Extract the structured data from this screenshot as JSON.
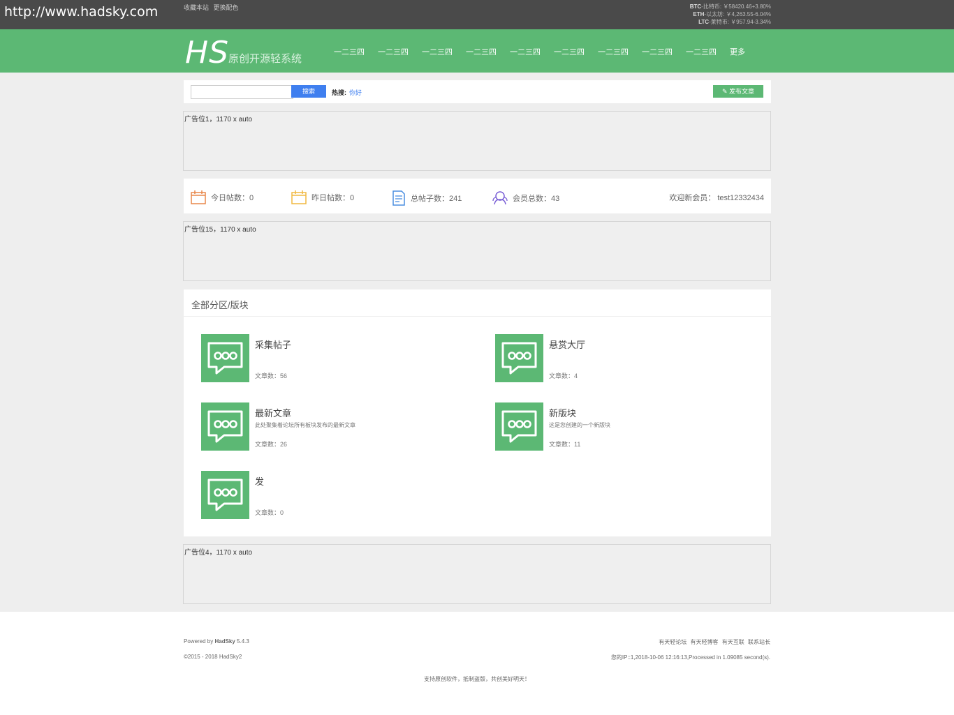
{
  "topbar": {
    "url": "http://www.hadsky.com",
    "links": [
      "收藏本站",
      "更换配色"
    ],
    "ticker": [
      {
        "name": "BTC",
        "desc": "-比特币: ￥58420.46+3.80%"
      },
      {
        "name": "ETH",
        "desc": "-以太坊: ￥4,263.55-6.04%"
      },
      {
        "name": "LTC",
        "desc": "-莱特币: ￥957.94-3.34%"
      }
    ]
  },
  "header": {
    "logo": "HS",
    "slogan": "原创开源轻系统",
    "nav": [
      "一二三四",
      "一二三四",
      "一二三四",
      "一二三四",
      "一二三四",
      "一二三四",
      "一二三四",
      "一二三四",
      "一二三四",
      "更多"
    ]
  },
  "search": {
    "value": "",
    "button": "搜索",
    "hot_label": "热搜:",
    "hot_keyword": "你好",
    "publish": "发布文章"
  },
  "ads": [
    "广告位1，1170 x auto",
    "广告位15，1170 x auto",
    "广告位4，1170 x auto"
  ],
  "stats": {
    "today": "今日帖数：0",
    "yesterday": "昨日帖数：0",
    "total": "总帖子数：241",
    "members": "会员总数：43",
    "welcome": "欢迎新会员：  test12332434"
  },
  "forum": {
    "title": "全部分区/版块",
    "boards": [
      {
        "name": "采集帖子",
        "desc": "",
        "count": "文章数：56"
      },
      {
        "name": "悬赏大厅",
        "desc": "",
        "count": "文章数：4"
      },
      {
        "name": "最新文章",
        "desc": "此处聚集着论坛所有板块发布的最新文章",
        "count": "文章数：26"
      },
      {
        "name": "新版块",
        "desc": "这是您创建的一个新版块",
        "count": "文章数：11"
      },
      {
        "name": "发",
        "desc": "",
        "count": "文章数：0"
      }
    ]
  },
  "footer": {
    "powered_prefix": "Powered by ",
    "powered_brand": "HadSky",
    "powered_version": " 5.4.3",
    "copyright": "©2015 - 2018 HadSky2",
    "links": [
      "有天轻论坛",
      "有天轻博客",
      "有天互联",
      "联系站长"
    ],
    "info": "您的IP::1,2018-10-06 12:16:13,Processed in 1.09085 second(s).",
    "slogan": "支持原创软件，抵制盗版，共创美好明天！"
  },
  "colors": {
    "brand_green": "#5cb874",
    "topbar": "#4a4a4a",
    "search_blue": "#3f7fef"
  }
}
